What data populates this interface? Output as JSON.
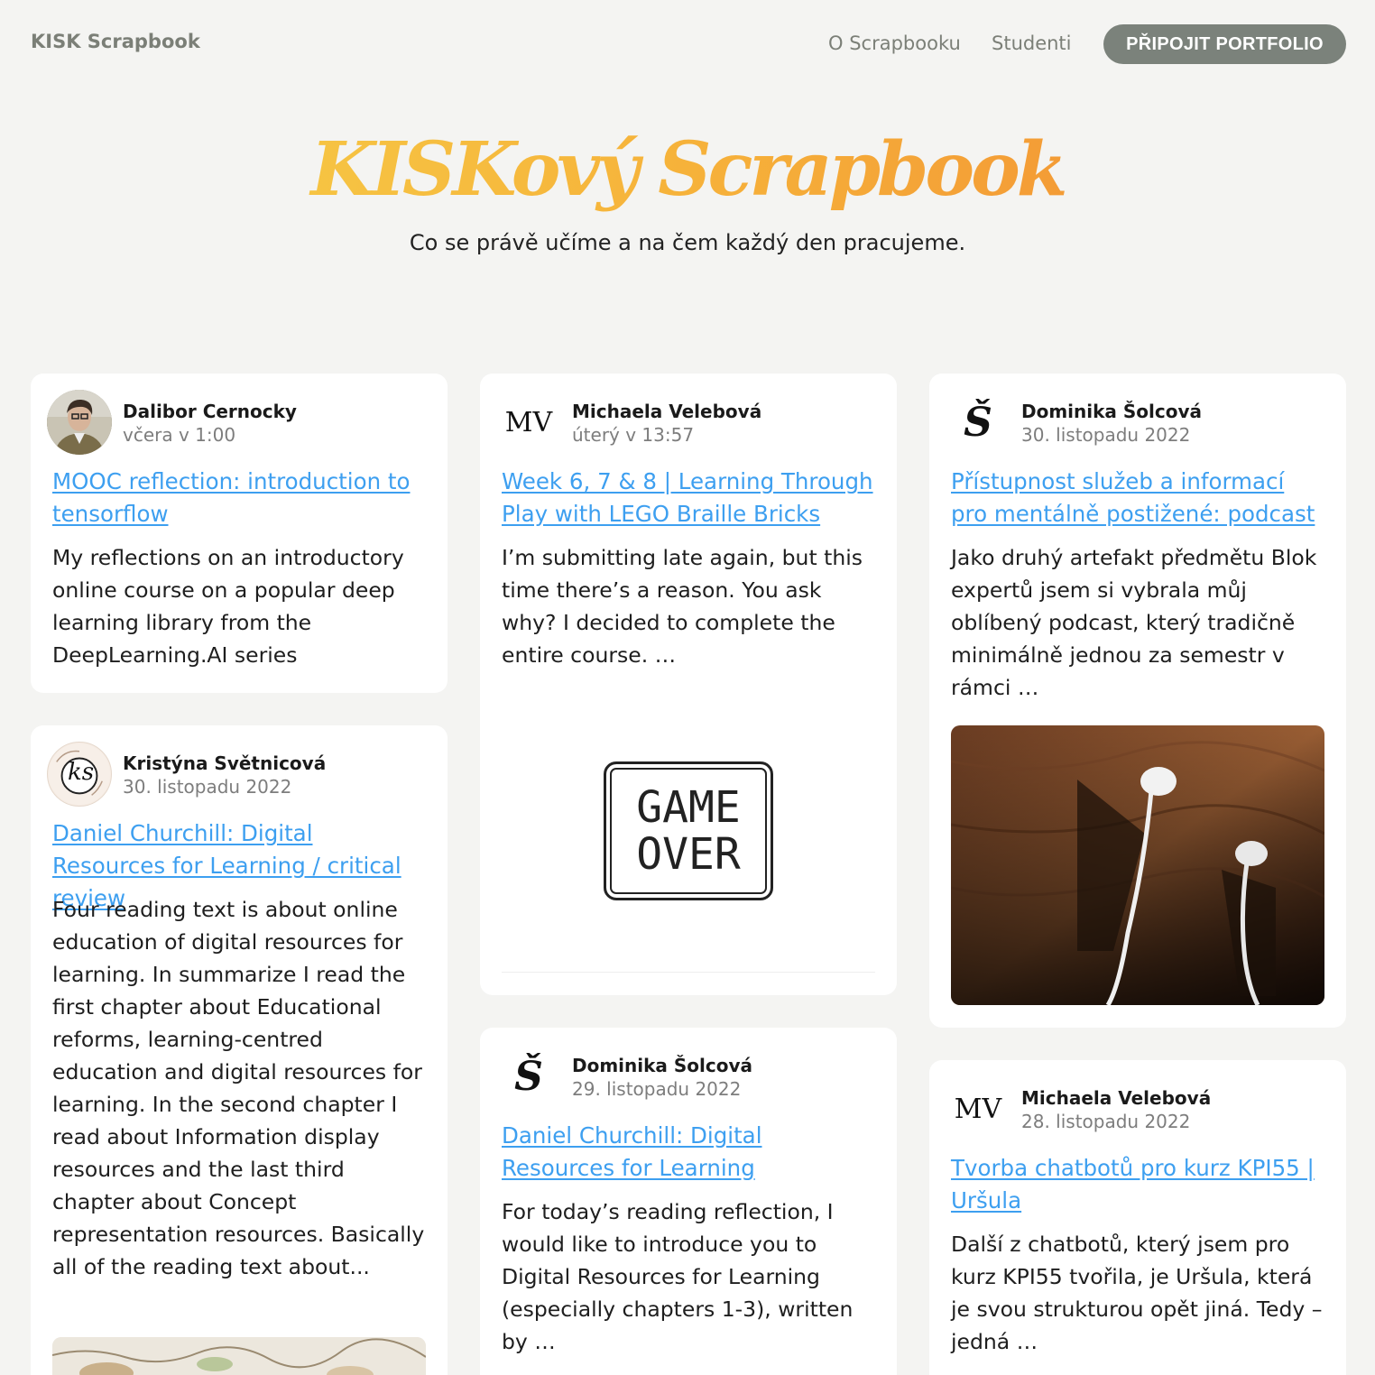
{
  "header": {
    "brand": "KISK Scrapbook",
    "nav": {
      "about": "O Scrapbooku",
      "students": "Studenti"
    },
    "cta": "PŘIPOJIT PORTFOLIO"
  },
  "hero": {
    "title": "KISKový Scrapbook",
    "subtitle": "Co se právě učíme a na čem každý den pracujeme."
  },
  "posts": [
    {
      "author": "Dalibor Cernocky",
      "date": "včera v 1:00",
      "title": "MOOC reflection: introduction to tensorflow",
      "excerpt": "My reflections on an introductory online course on a popular deep learning library from the DeepLearning.AI series"
    },
    {
      "author": "Kristýna Světnicová",
      "date": "30. listopadu 2022",
      "avatar_text": "ks",
      "title": "Daniel Churchill: Digital Resources for Learning / critical review",
      "excerpt": "Four reading text is about online education of digital resources for learning. In summarize I read the first chapter about Educational reforms, learning-centred education and digital resources for learning. In the second chapter I read about Information display resources and the last third chapter about Concept representation resources. Basically all of the reading text about..."
    },
    {
      "author": "Michaela Velebová",
      "date": "úterý v 13:57",
      "avatar_text": "MV",
      "title": "Week 6, 7 & 8 | Learning Through Play with LEGO Braille Bricks",
      "excerpt": "I’m submitting late again, but this time there’s a reason. You ask why? I decided to complete the entire course. …",
      "image_text_1": "GAME",
      "image_text_2": "OVER"
    },
    {
      "author": "Dominika Šolcová",
      "date": "29. listopadu 2022",
      "avatar_text": "Š",
      "title": "Daniel Churchill: Digital Resources for Learning",
      "excerpt": "For today’s reading reflection, I would like to introduce you to Digital Resources for Learning (especially chapters 1-3), written by …"
    },
    {
      "author": "Dominika Šolcová",
      "date": "30. listopadu 2022",
      "avatar_text": "Š",
      "title": "Přístupnost služeb a informací pro mentálně postižené: podcast",
      "excerpt": "Jako druhý artefakt předmětu Blok expertů jsem si vybrala můj oblíbený podcast, který tradičně minimálně jednou za semestr v rámci …"
    },
    {
      "author": "Michaela Velebová",
      "date": "28. listopadu 2022",
      "avatar_text": "MV",
      "title": "Tvorba chatbotů pro kurz KPI55 | Uršula",
      "excerpt": "Další z chatbotů, který jsem pro kurz KPI55 tvořila, je Uršula, která je svou strukturou opět jiná. Tedy – jedná …"
    }
  ]
}
